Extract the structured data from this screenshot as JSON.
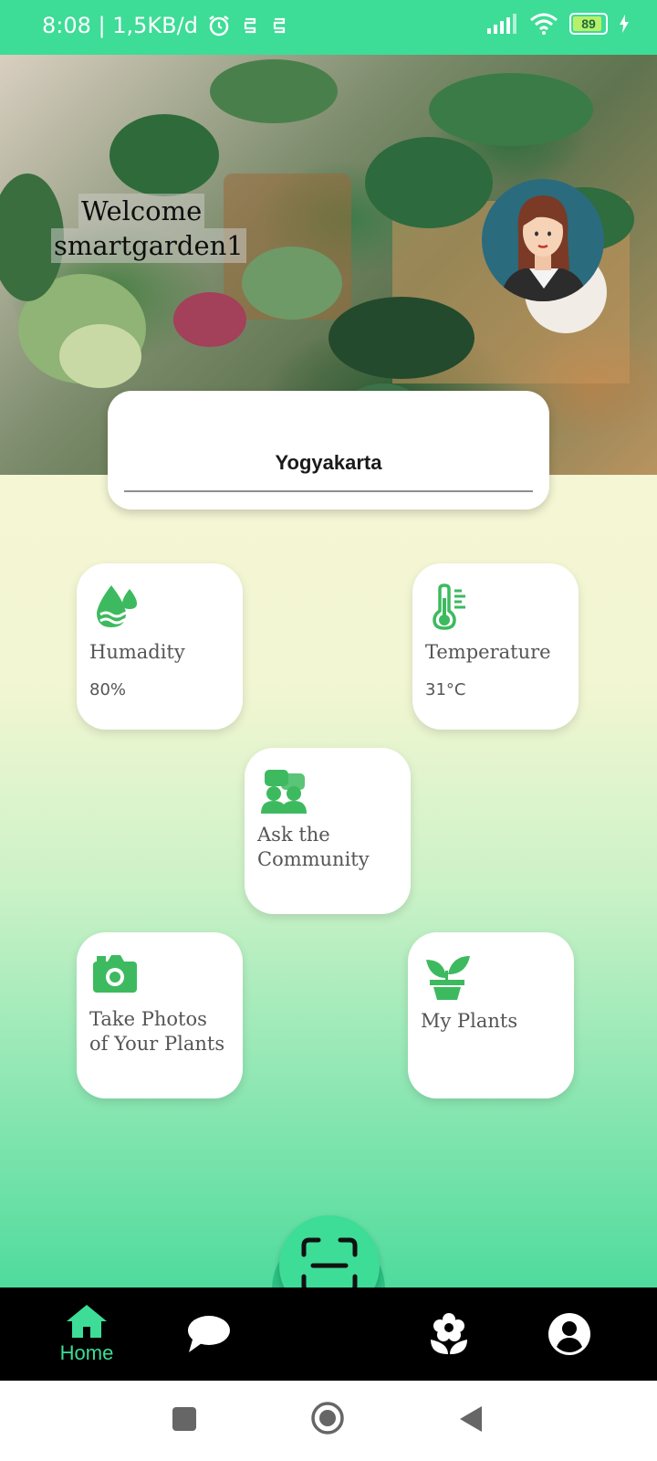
{
  "status": {
    "time_info": "8:08 | 1,5KB/d",
    "battery": "89"
  },
  "header": {
    "welcome": "Welcome",
    "username": "smartgarden1"
  },
  "location": {
    "city": "Yogyakarta"
  },
  "tiles": {
    "humidity": {
      "title": "Humadity",
      "value": "80%"
    },
    "temperature": {
      "title": "Temperature",
      "value": "31°C"
    },
    "community": {
      "title_line1": "Ask the",
      "title_line2": "Community"
    },
    "photos": {
      "title_line1": "Take Photos",
      "title_line2": "of Your Plants"
    },
    "plants": {
      "title": "My Plants"
    }
  },
  "nav": {
    "home_label": "Home"
  },
  "colors": {
    "accent": "#3ddc97",
    "icon_green": "#3dba5f"
  }
}
